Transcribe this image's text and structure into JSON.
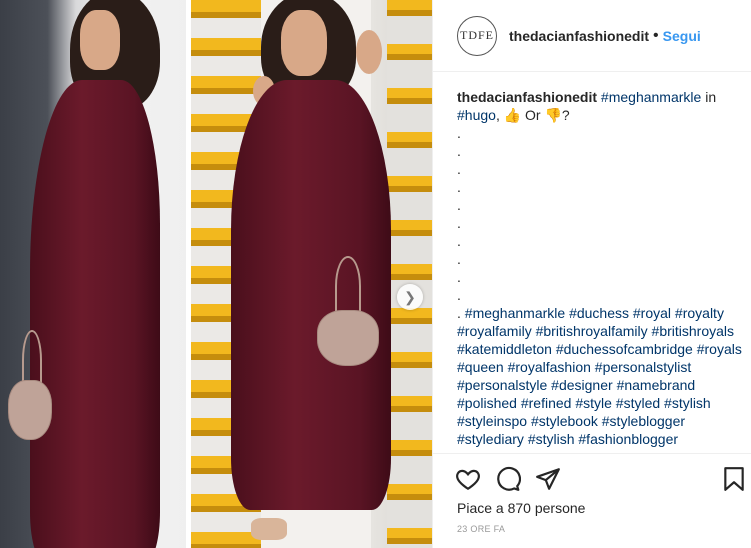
{
  "post": {
    "header": {
      "avatar_text": "TDFE",
      "username": "thedacianfashionedit",
      "separator": "•",
      "follow_label": "Segui"
    },
    "caption": {
      "username": "thedacianfashionedit",
      "lead_tag": "#meghanmarkle",
      "text_1": " in",
      "tag_hugo": "#hugo",
      "text_2": ", 👍 Or 👎?",
      "dots": [
        ".",
        ".",
        ".",
        ".",
        ".",
        ".",
        ".",
        ".",
        ".",
        "."
      ],
      "dot_prefix": ". ",
      "hashtags": [
        "#meghanmarkle",
        "#duchess",
        "#royal",
        "#royalty",
        "#royalfamily",
        "#britishroyalfamily",
        "#britishroyals",
        "#katemiddleton",
        "#duchessofcambridge",
        "#royals",
        "#queen",
        "#royalfashion",
        "#personalstylist",
        "#personalstyle",
        "#designer",
        "#namebrand",
        "#polished",
        "#refined",
        "#style",
        "#styled",
        "#stylish",
        "#styleinspo",
        "#stylebook",
        "#styleblogger",
        "#stylediary",
        "#stylish",
        "#fashionblogger"
      ]
    },
    "likes_text": "Piace a 870 persone",
    "time_text": "23 ORE FA",
    "icons": {
      "like": "heart-icon",
      "comment": "comment-icon",
      "share": "share-icon",
      "save": "bookmark-icon",
      "next": "chevron-right-icon"
    },
    "colors": {
      "link": "#3897f0",
      "hashtag": "#003569",
      "dress": "#5a1424"
    }
  }
}
